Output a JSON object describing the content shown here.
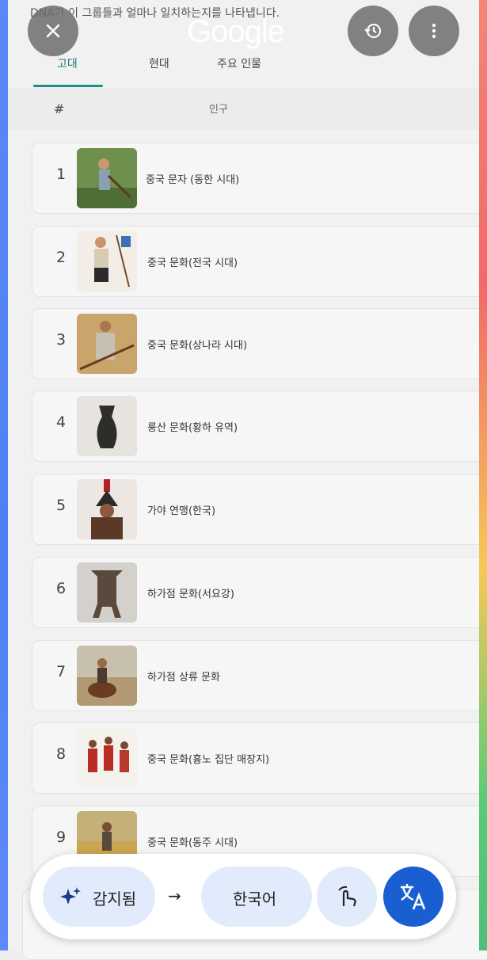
{
  "header": {
    "description": "DNA가 이 그룹들과 얼마나 일치하는지를 나타냅니다.",
    "logo": "Google"
  },
  "tabs": [
    {
      "label": "고대",
      "active": true
    },
    {
      "label": "현대",
      "active": false
    },
    {
      "label": "주요 인물",
      "active": false
    }
  ],
  "table": {
    "columns": [
      "#",
      "인구"
    ],
    "rows": [
      {
        "rank": "1",
        "label": "중국 문자 (동한 시대)",
        "icon": "farmer-image"
      },
      {
        "rank": "2",
        "label": "중국 문화(전국 시대)",
        "icon": "warrior-image"
      },
      {
        "rank": "3",
        "label": "중국 문화(상나라 시대)",
        "icon": "spear-man-image"
      },
      {
        "rank": "4",
        "label": "룽산 문화(황하 유역)",
        "icon": "black-vase-image"
      },
      {
        "rank": "5",
        "label": "가야 연맹(한국)",
        "icon": "helmet-warrior-image"
      },
      {
        "rank": "6",
        "label": "하가점 문화(서요강)",
        "icon": "bronze-vessel-image"
      },
      {
        "rank": "7",
        "label": "하가점 상류 문화",
        "icon": "horse-rider-image"
      },
      {
        "rank": "8",
        "label": "중국 문화(흉노 집단 매장지)",
        "icon": "soldiers-image"
      },
      {
        "rank": "9",
        "label": "중국 문화(동주 시대)",
        "icon": "field-people-image"
      }
    ]
  },
  "bottom_bar": {
    "detected_label": "감지됨",
    "arrow": "→",
    "target_language": "한국어"
  },
  "colors": {
    "accent": "#1a8f86",
    "translate": "#1a5fd1",
    "pill": "#e2ebfb"
  }
}
